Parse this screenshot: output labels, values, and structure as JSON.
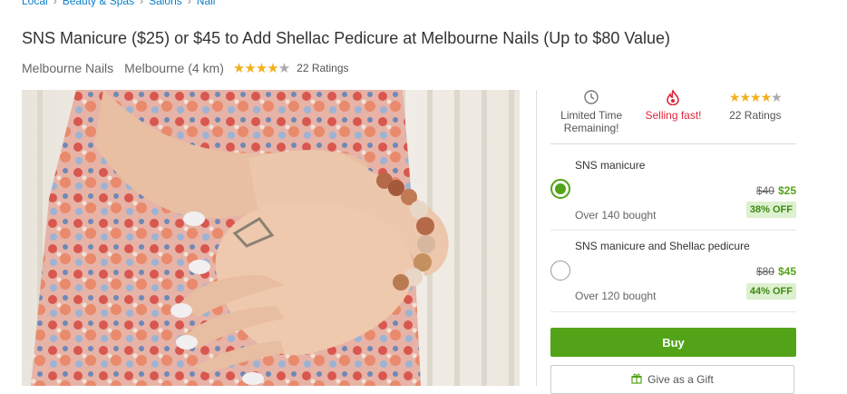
{
  "breadcrumb": [
    "Local",
    "Beauty & Spas",
    "Salons",
    "Nail"
  ],
  "deal": {
    "title": "SNS Manicure ($25) or $45 to Add Shellac Pedicure at Melbourne Nails (Up to $80 Value)",
    "merchant": "Melbourne Nails",
    "location": "Melbourne (4 km)",
    "rating": 4.5,
    "ratings_label": "22 Ratings"
  },
  "photo": {
    "icon": "photo-hands-ring"
  },
  "info": {
    "limited_label": "Limited Time Remaining!",
    "selling_label": "Selling fast!",
    "ratings_label": "22 Ratings",
    "rating": 4.5
  },
  "options": [
    {
      "title": "SNS manicure",
      "bought": "Over 140 bought",
      "old_price": "$40",
      "new_price": "$25",
      "discount": "38% OFF",
      "selected": true
    },
    {
      "title": "SNS manicure and Shellac pedicure",
      "bought": "Over 120 bought",
      "old_price": "$80",
      "new_price": "$45",
      "discount": "44% OFF",
      "selected": false
    }
  ],
  "actions": {
    "buy_label": "Buy",
    "gift_label": "Give as a Gift"
  },
  "colors": {
    "accent": "#53a318",
    "link": "#0a7fc6",
    "hot": "#e0263c",
    "star": "#f2b01e",
    "badge_bg": "#ddf0cf"
  }
}
